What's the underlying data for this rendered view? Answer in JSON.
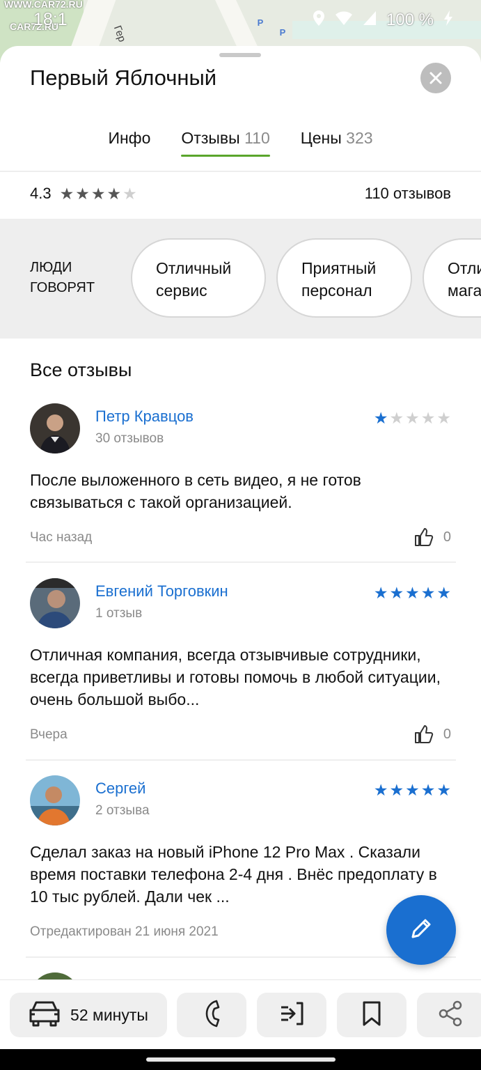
{
  "status_bar": {
    "time": "18:1",
    "watermark_top": "WWW.CAR72.RU",
    "watermark_bottom": "CAR72.RU",
    "battery": "100 %",
    "map_street_label": "Гер",
    "parking_label": "P"
  },
  "place": {
    "title": "Первый Яблочный"
  },
  "tabs": [
    {
      "label": "Инфо",
      "count": ""
    },
    {
      "label": "Отзывы",
      "count": "110"
    },
    {
      "label": "Цены",
      "count": "323"
    }
  ],
  "rating": {
    "value": "4.3",
    "stars_filled": 4,
    "total_label": "110 отзывов"
  },
  "people_say": {
    "label": "ЛЮДИ ГОВОРЯТ",
    "chips": [
      {
        "line1": "Отличный",
        "line2": "сервис"
      },
      {
        "line1": "Приятный",
        "line2": "персонал"
      },
      {
        "line1": "Отли",
        "line2": "мага"
      }
    ]
  },
  "reviews_section": {
    "title": "Все отзывы"
  },
  "reviews": [
    {
      "author": "Петр Кравцов",
      "author_reviews": "30 отзывов",
      "stars": 1,
      "text": "После выложенного в сеть видео, я не готов связываться с такой организацией.",
      "date": "Час назад",
      "likes": "0"
    },
    {
      "author": "Евгений Торговкин",
      "author_reviews": "1 отзыв",
      "stars": 5,
      "text": "Отличная компания, всегда отзывчивые сотрудники, всегда приветливы и готовы помочь в любой ситуации, очень большой выбо...",
      "date": "Вчера",
      "likes": "0"
    },
    {
      "author": "Сергей",
      "author_reviews": "2 отзыва",
      "stars": 5,
      "text": "Сделал заказ на новый iPhone 12 Pro Max . Сказали время поставки телефона 2-4 дня . Внёс предоплату в 10 тыс рублей. Дали чек ...",
      "date": "Отредактирован 21 июня 2021",
      "likes": ""
    }
  ],
  "action_bar": {
    "route_label": "52 минуты"
  },
  "colors": {
    "accent_blue": "#1a6fd0",
    "tab_underline": "#5aa52c",
    "muted_text": "#8a8a8a",
    "band_gray": "#eeeeee"
  },
  "icons": {
    "close": "close-icon",
    "star": "star-icon",
    "like": "thumbs-up-icon",
    "edit": "pencil-icon",
    "car": "car-icon",
    "phone": "phone-icon",
    "enter": "entrance-icon",
    "bookmark": "bookmark-icon",
    "share": "share-icon"
  }
}
